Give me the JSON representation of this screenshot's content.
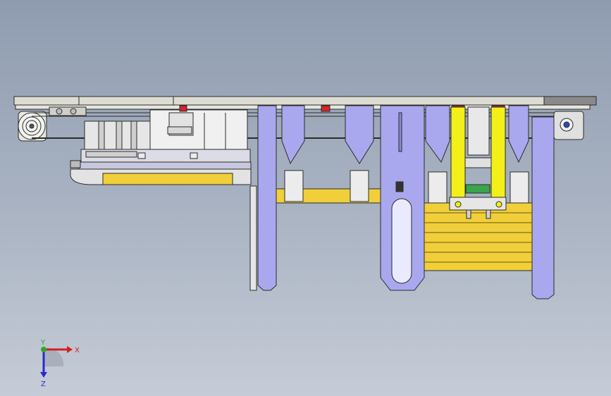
{
  "colors": {
    "background_top": "#8f9cb0",
    "background_bottom": "#c6ccd7",
    "plate_light": "#dcdcd2",
    "frame_lavender": "#a9a8ee",
    "panel_yellow": "#f0cf3a",
    "highlight_yellow": "#f3ef18",
    "accent_red": "#d8232a",
    "accent_green": "#3aa54a",
    "outline": "#2b2b2b"
  },
  "axis_triad": {
    "x_label": "X",
    "y_label": "Y",
    "z_label": "Z",
    "x_color": "#d22020",
    "y_color": "#2da82d",
    "z_color": "#2a2ad0"
  }
}
